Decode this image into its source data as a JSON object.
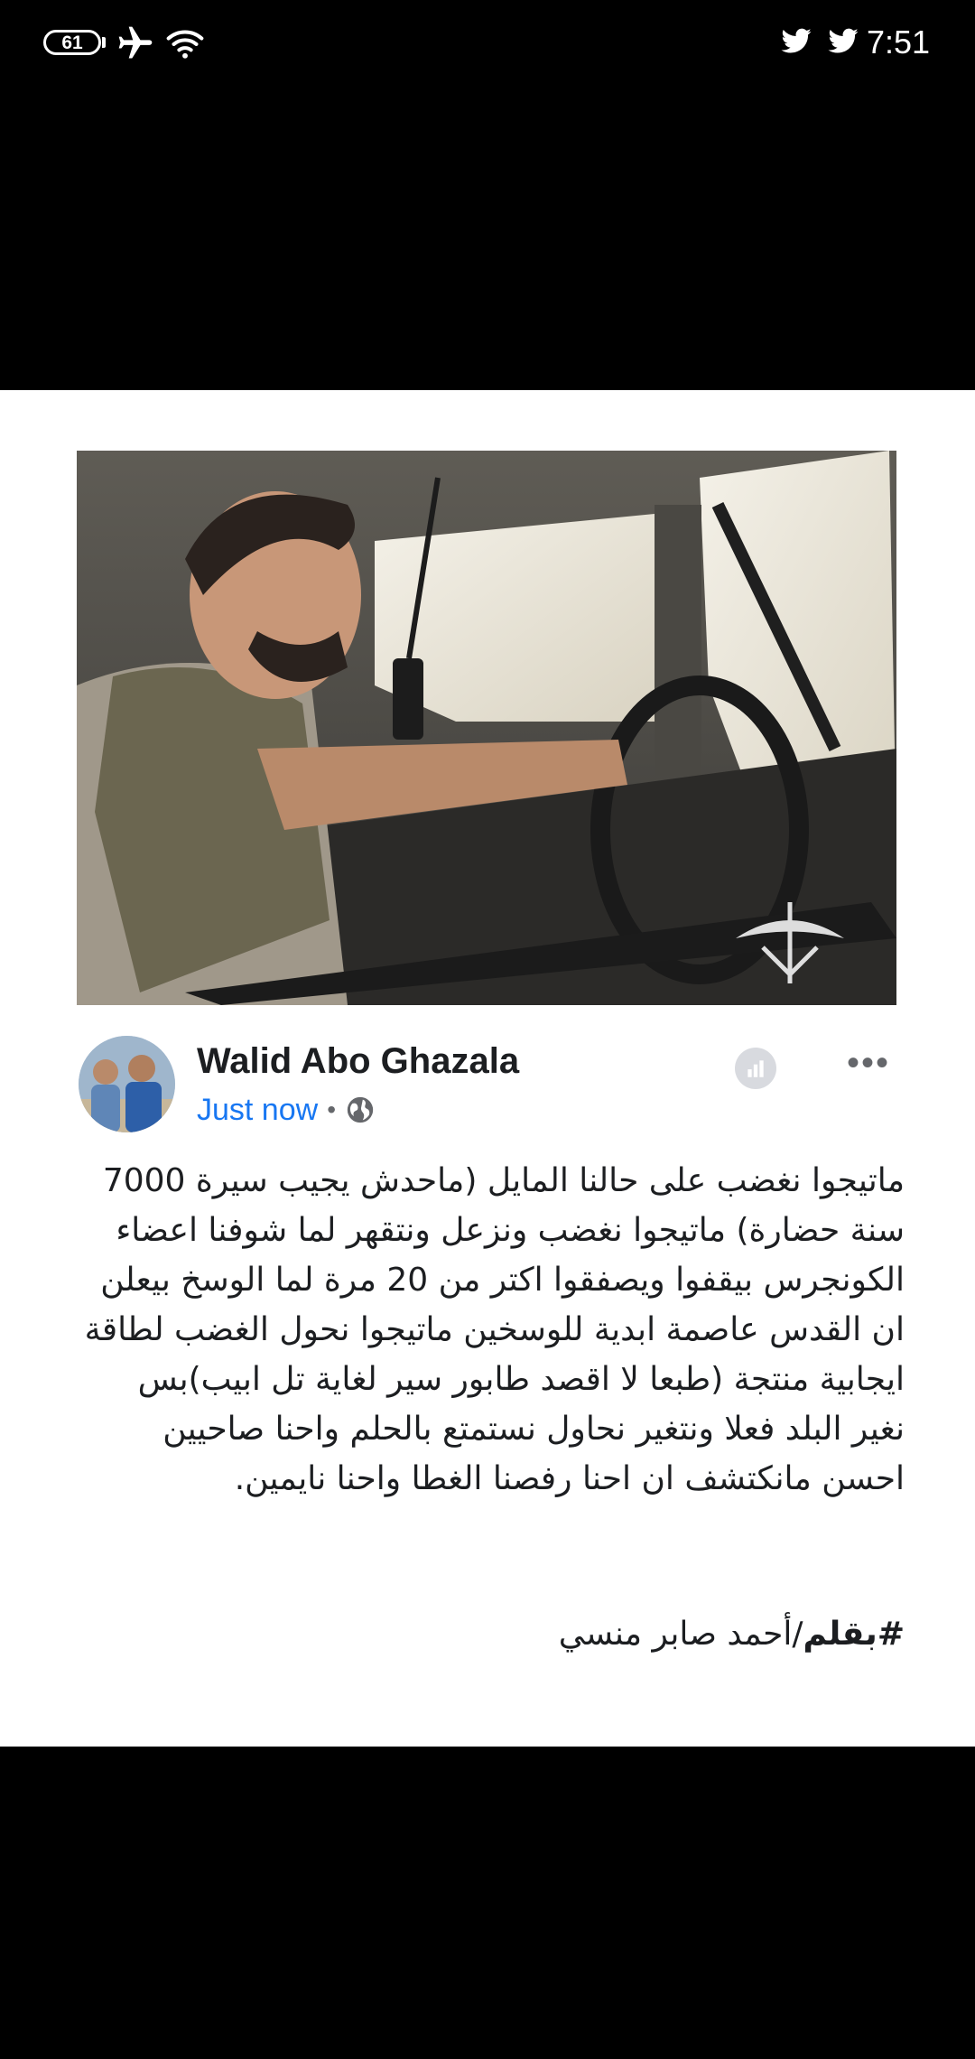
{
  "status_bar": {
    "battery_level": "61",
    "time": "7:51",
    "icons": [
      "battery-icon",
      "airplane-mode-icon",
      "wifi-icon",
      "twitter-icon",
      "twitter-icon"
    ]
  },
  "post": {
    "author_name": "Walid Abo Ghazala",
    "timestamp": "Just now",
    "separator": "•",
    "privacy_icon": "globe-icon",
    "more_label": "•••",
    "body_text": "ماتيجوا نغضب على حالنا المايل (ماحدش يجيب سيرة 7000 سنة حضارة) ماتيجوا نغضب ونزعل ونتقهر لما شوفنا اعضاء الكونجرس بيقفوا ويصفقوا اكتر من 20 مرة لما الوسخ بيعلن ان القدس عاصمة ابدية للوسخين ماتيجوا نحول الغضب لطاقة ايجابية منتجة (طبعا لا اقصد طابور سير لغاية تل ابيب)بس نغير البلد فعلا ونتغير نحاول نستمتع بالحلم واحنا صاحيين احسن مانكتشف ان احنا رفصنا الغطا واحنا نايمين.",
    "hashtag": "#بقلم",
    "signature": "/أحمد صابر منسي"
  },
  "colors": {
    "link_blue": "#1877f2",
    "text_dark": "#1c1e21",
    "meta_gray": "#65676b"
  }
}
